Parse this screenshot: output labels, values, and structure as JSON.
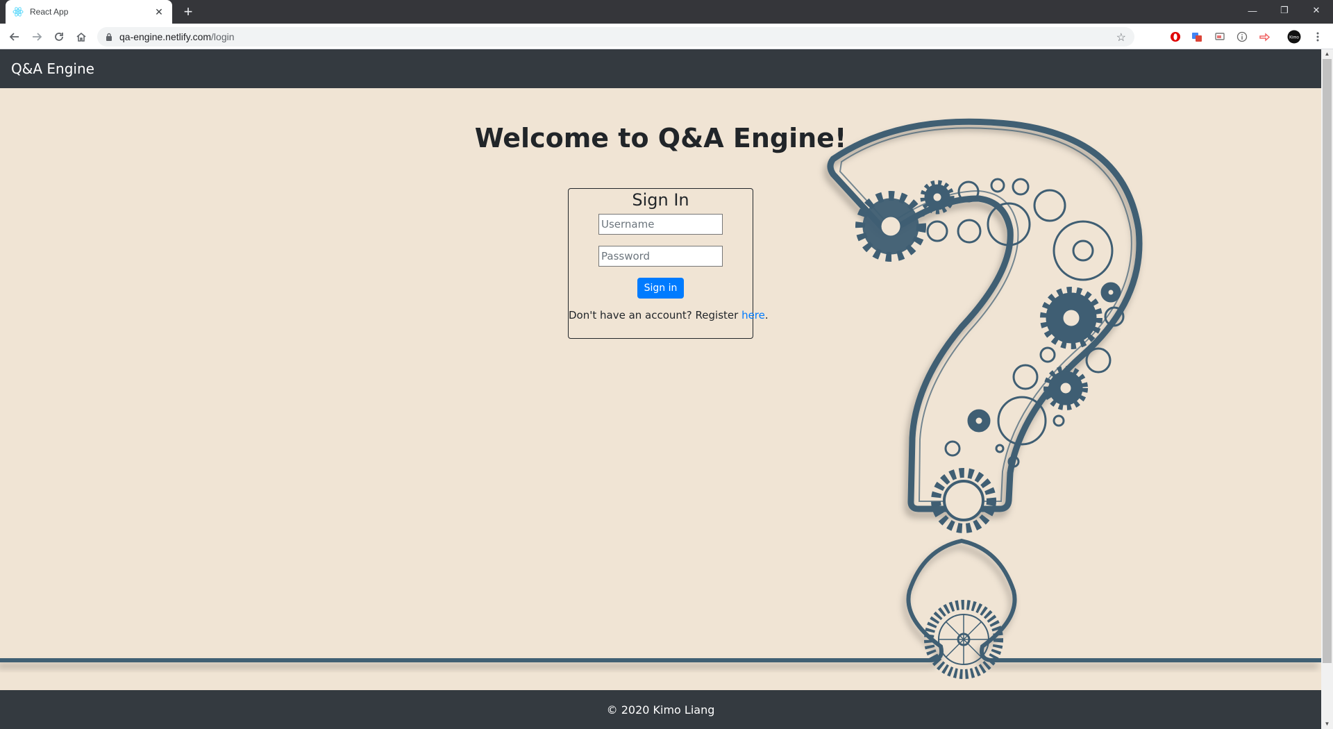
{
  "browser": {
    "tab_title": "React App",
    "tab_close": "✕",
    "new_tab": "+",
    "url_host": "qa-engine.netlify.com",
    "url_path": "/login",
    "window_controls": {
      "minimize": "—",
      "restore": "❐",
      "close": "✕"
    }
  },
  "navbar": {
    "brand": "Q&A Engine"
  },
  "main": {
    "heading": "Welcome to Q&A Engine!"
  },
  "signin": {
    "title": "Sign In",
    "username_placeholder": "Username",
    "password_placeholder": "Password",
    "button": "Sign in",
    "register_text": "Don't have an account? Register ",
    "register_link": "here",
    "register_suffix": "."
  },
  "footer": {
    "text": "© 2020 Kimo Liang"
  },
  "colors": {
    "page_bg": "#f0e4d4",
    "navbar_bg": "#343a40",
    "primary": "#007bff",
    "art_stroke": "#3f5e73"
  },
  "icons": {
    "favicon": "react-logo-icon",
    "back": "arrow-left-icon",
    "forward": "arrow-right-icon",
    "reload": "reload-icon",
    "home": "home-icon",
    "lock": "lock-icon",
    "star": "star-icon",
    "extensions": [
      "opera-icon",
      "translate-icon",
      "cast-icon",
      "info-icon",
      "share-icon",
      "profile-icon"
    ],
    "menu": "kebab-menu-icon"
  }
}
